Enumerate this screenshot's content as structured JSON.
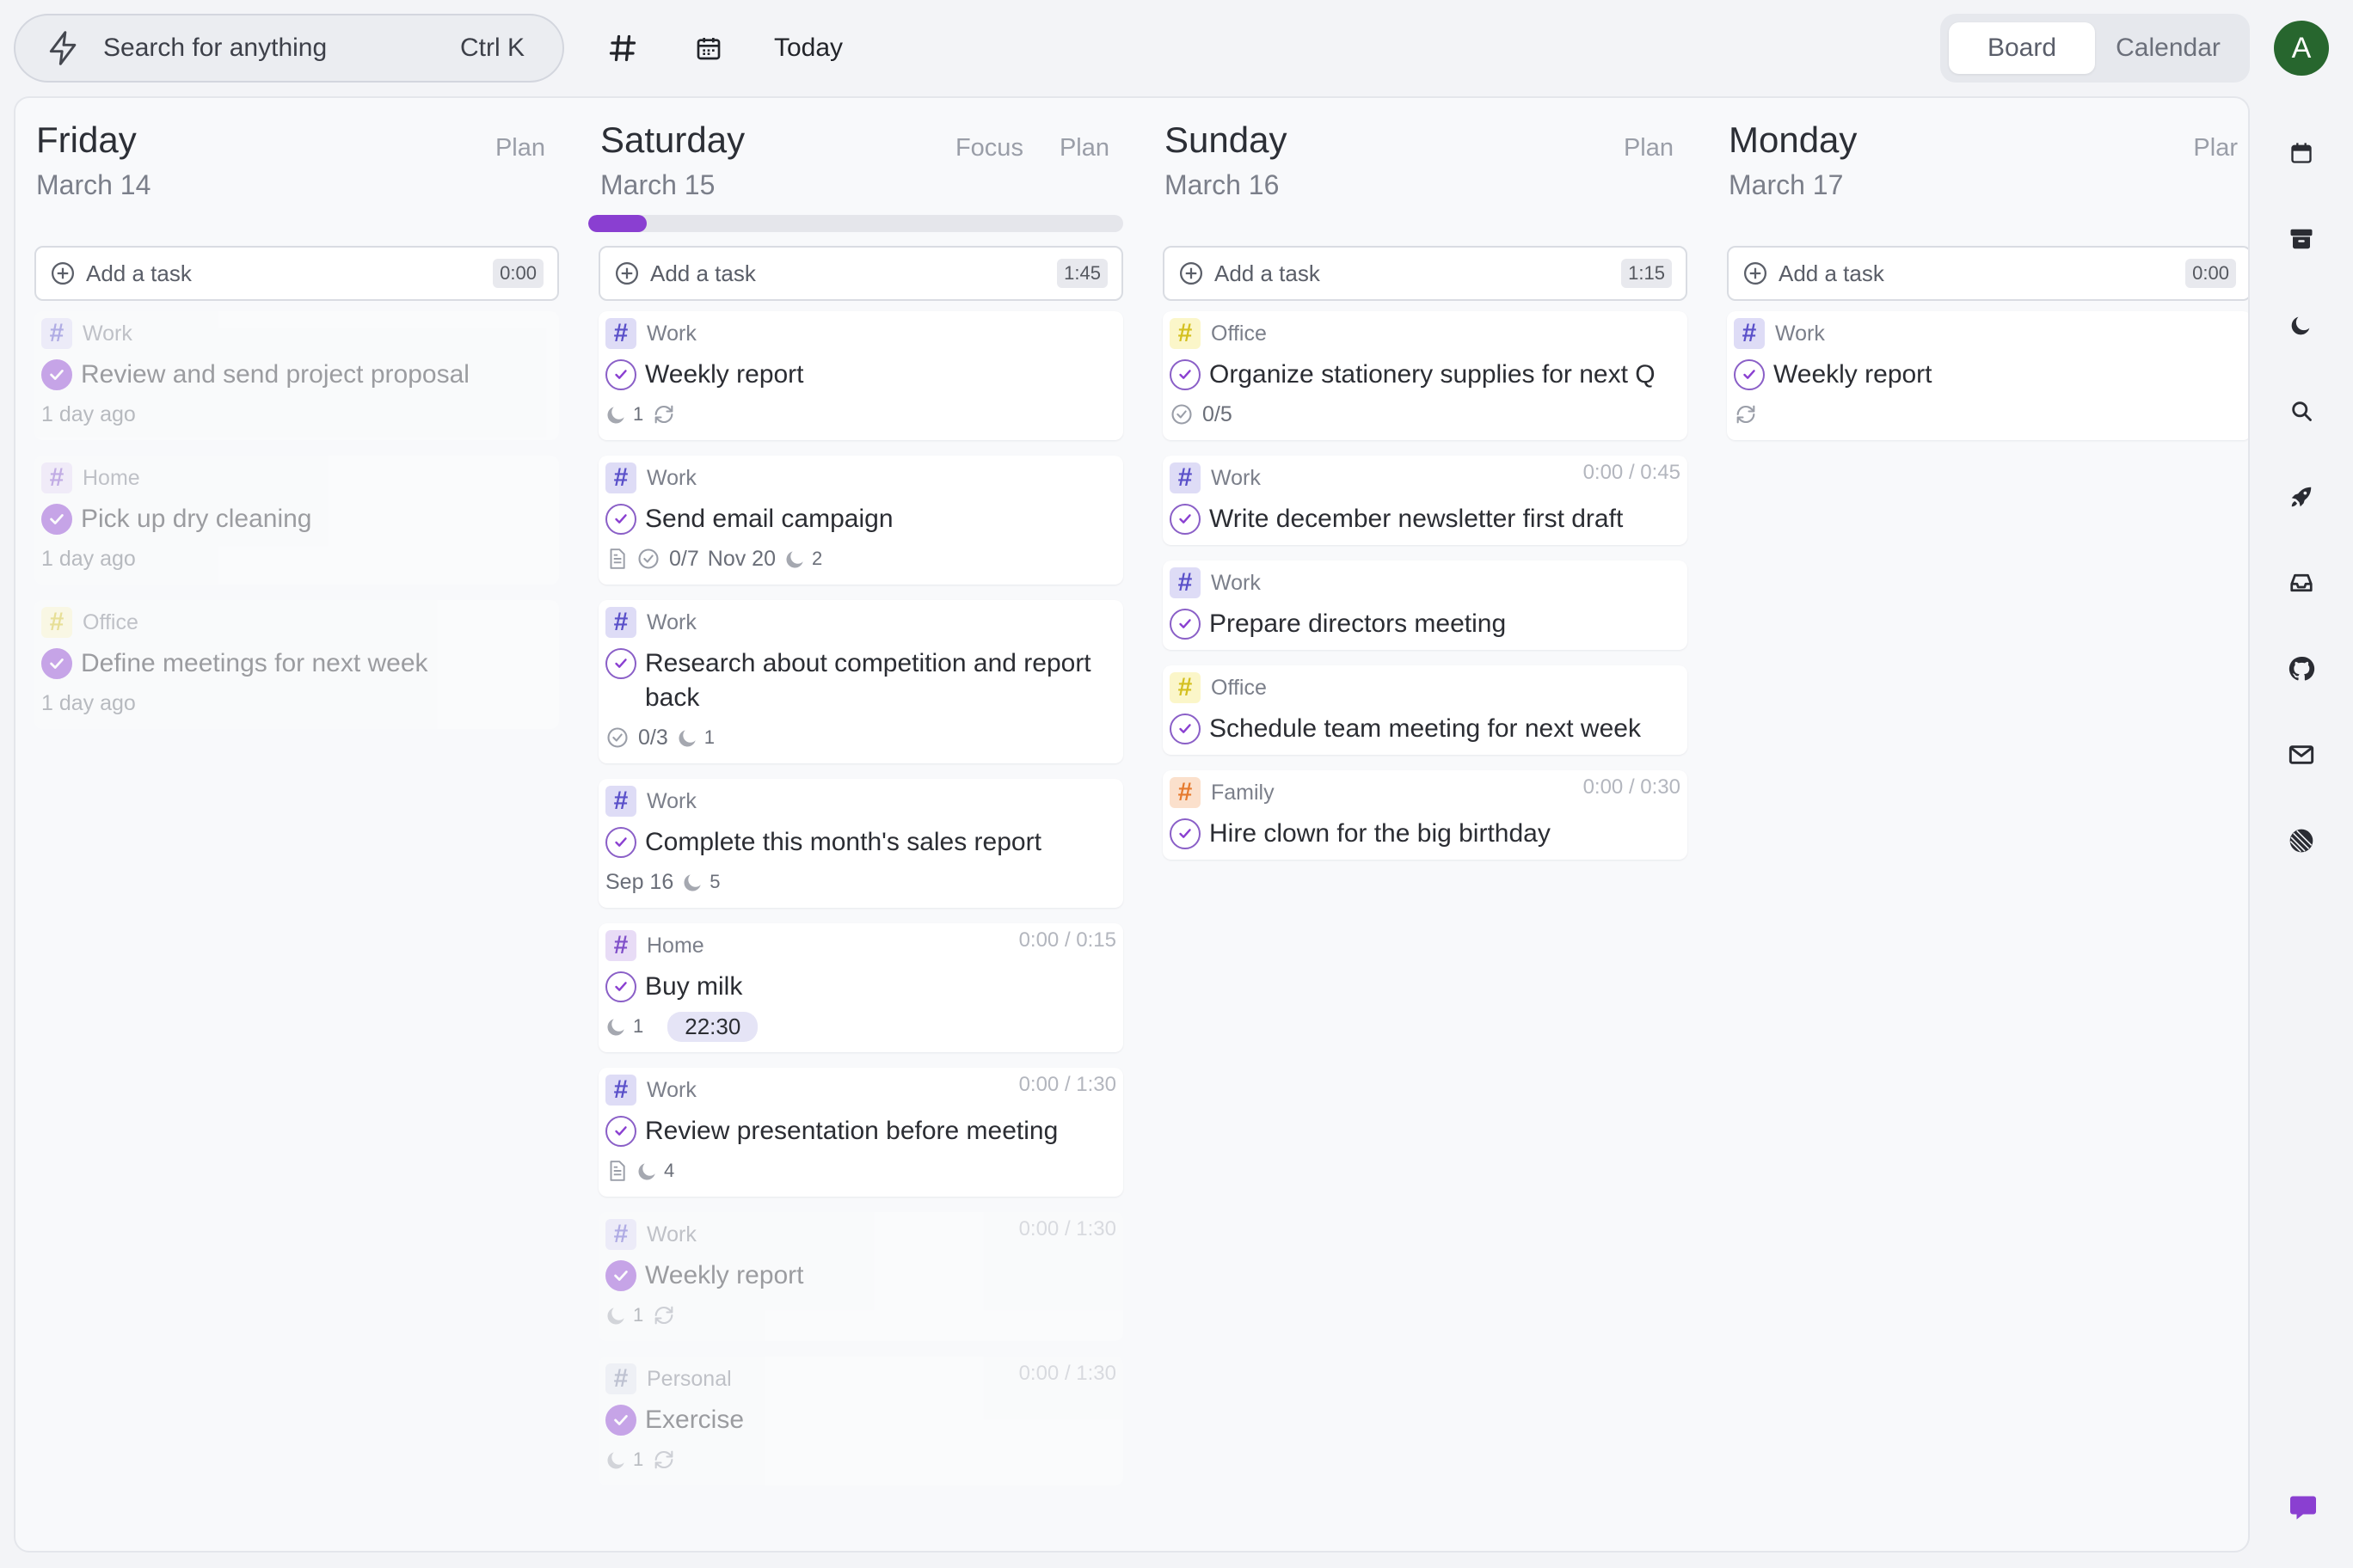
{
  "header": {
    "search_placeholder": "Search for anything",
    "search_shortcut": "Ctrl K",
    "today_label": "Today",
    "view_board": "Board",
    "view_calendar": "Calendar",
    "avatar_initial": "A"
  },
  "colors": {
    "accent": "#8a3fd1",
    "avatar": "#27662e",
    "tag_work_bg": "#dedcf6",
    "tag_work_fg": "#5a50c9",
    "tag_home_bg": "#e8dcf6",
    "tag_home_fg": "#8050c9",
    "tag_office_bg": "#fbf6c9",
    "tag_office_fg": "#d4c020",
    "tag_family_bg": "#fbe0cc",
    "tag_family_fg": "#e67a2e",
    "tag_personal_bg": "#e4e6ef",
    "tag_personal_fg": "#7a80a0"
  },
  "columns": [
    {
      "day": "Friday",
      "date": "March 14",
      "actions": [
        "Plan"
      ],
      "add_task_label": "Add a task",
      "total": "0:00",
      "tasks": [
        {
          "tag": "Work",
          "title": "Review and send project proposal",
          "meta": "1 day ago",
          "done": true
        },
        {
          "tag": "Home",
          "title": "Pick up dry cleaning",
          "meta": "1 day ago",
          "done": true
        },
        {
          "tag": "Office",
          "title": "Define meetings for next week",
          "meta": "1 day ago",
          "done": true
        }
      ]
    },
    {
      "day": "Saturday",
      "date": "March 15",
      "actions": [
        "Focus",
        "Plan"
      ],
      "progress": 0.11,
      "add_task_label": "Add a task",
      "total": "1:45",
      "tasks": [
        {
          "tag": "Work",
          "title": "Weekly report",
          "pomodoros": "1",
          "repeat": true
        },
        {
          "tag": "Work",
          "title": "Send email campaign",
          "note": true,
          "subtasks": "0/7",
          "due": "Nov 20",
          "pomodoros": "2"
        },
        {
          "tag": "Work",
          "title": "Research about competition and report back",
          "subtasks": "0/3",
          "pomodoros": "1"
        },
        {
          "tag": "Work",
          "title": "Complete this month's sales report",
          "due": "Sep 16",
          "pomodoros": "5"
        },
        {
          "tag": "Home",
          "title": "Buy milk",
          "estimate": "0:00 / 0:15",
          "pomodoros": "1",
          "time": "22:30"
        },
        {
          "tag": "Work",
          "title": "Review presentation before meeting",
          "estimate": "0:00 / 1:30",
          "note": true,
          "pomodoros": "4"
        },
        {
          "tag": "Work",
          "title": "Weekly report",
          "estimate": "0:00 / 1:30",
          "pomodoros": "1",
          "repeat": true,
          "done": true
        },
        {
          "tag": "Personal",
          "title": "Exercise",
          "estimate": "0:00 / 1:30",
          "pomodoros": "1",
          "repeat": true,
          "done": true
        }
      ]
    },
    {
      "day": "Sunday",
      "date": "March 16",
      "actions": [
        "Plan"
      ],
      "add_task_label": "Add a task",
      "total": "1:15",
      "tasks": [
        {
          "tag": "Office",
          "title": "Organize stationery supplies for next Q",
          "subtasks": "0/5"
        },
        {
          "tag": "Work",
          "title": "Write december newsletter first draft",
          "estimate": "0:00 / 0:45"
        },
        {
          "tag": "Work",
          "title": "Prepare directors meeting"
        },
        {
          "tag": "Office",
          "title": "Schedule team meeting for next week"
        },
        {
          "tag": "Family",
          "title": "Hire clown for the big birthday",
          "estimate": "0:00 / 0:30"
        }
      ]
    },
    {
      "day": "Monday",
      "date": "March 17",
      "actions": [
        "Plar"
      ],
      "add_task_label": "Add a task",
      "total": "0:00",
      "tasks": [
        {
          "tag": "Work",
          "title": "Weekly report",
          "repeat": true
        }
      ]
    }
  ],
  "sidebar_icons": [
    "calendar-icon",
    "archive-icon",
    "moon-icon",
    "search-icon",
    "rocket-icon",
    "inbox-icon",
    "github-icon",
    "mail-icon",
    "linear-icon",
    "chat-icon"
  ]
}
